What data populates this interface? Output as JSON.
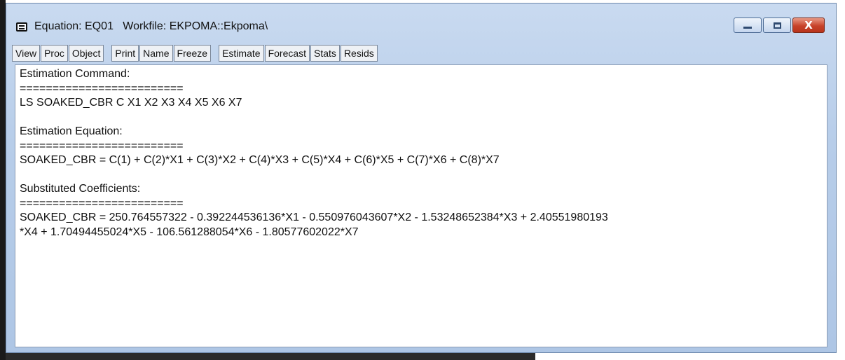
{
  "window": {
    "title": "Equation: EQ01   Workfile: EKPOMA::Ekpoma\\",
    "minimize_icon": "minimize-icon",
    "maximize_icon": "maximize-icon",
    "close_icon": "close-icon",
    "close_glyph": "X"
  },
  "toolbar": {
    "group1": [
      "View",
      "Proc",
      "Object"
    ],
    "group2": [
      "Print",
      "Name",
      "Freeze"
    ],
    "group3": [
      "Estimate",
      "Forecast",
      "Stats",
      "Resids"
    ]
  },
  "output": {
    "command_heading": "Estimation Command:",
    "separator": "=========================",
    "command": "LS SOAKED_CBR C X1 X2 X3 X4 X5 X6 X7",
    "equation_heading": "Estimation Equation:",
    "equation": "SOAKED_CBR = C(1) + C(2)*X1 + C(3)*X2 + C(4)*X3 + C(5)*X4 + C(6)*X5 + C(7)*X6 + C(8)*X7",
    "coef_heading": "Substituted Coefficients:",
    "coef_line1": "SOAKED_CBR = 250.764557322 - 0.392244536136*X1 - 0.550976043607*X2 - 1.53248652384*X3 + 2.40551980193",
    "coef_line2": "*X4 + 1.70494455024*X5 - 106.561288054*X6 - 1.80577602022*X7"
  }
}
